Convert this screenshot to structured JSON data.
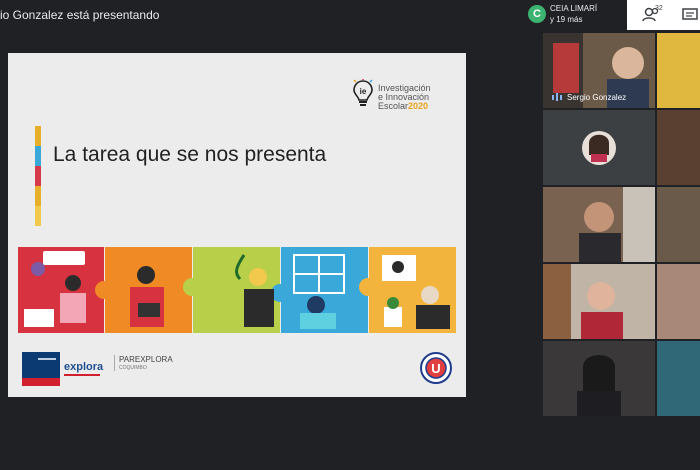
{
  "presenting_label": "io Gonzalez está presentando",
  "slide": {
    "logo_line1": "Investigación",
    "logo_line2": "e Innovación",
    "logo_line3": "Escolar",
    "logo_year": "2020",
    "title": "La tarea que se nos presenta",
    "footer_explora": "explora",
    "footer_parexplora": "PAREXPLORA",
    "footer_coquimbo": "COQUIMBO"
  },
  "panel": {
    "avatar_letter": "C",
    "group_name": "CEIA LIMARÍ",
    "group_more": "y 19 más",
    "people_count": "32"
  },
  "participants": [
    {
      "name": "Sergio Gonzalez"
    }
  ],
  "colors": {
    "bar": [
      "#e8b02a",
      "#3aa8d8",
      "#d63a4a",
      "#e8b02a",
      "#f2c94c"
    ]
  }
}
